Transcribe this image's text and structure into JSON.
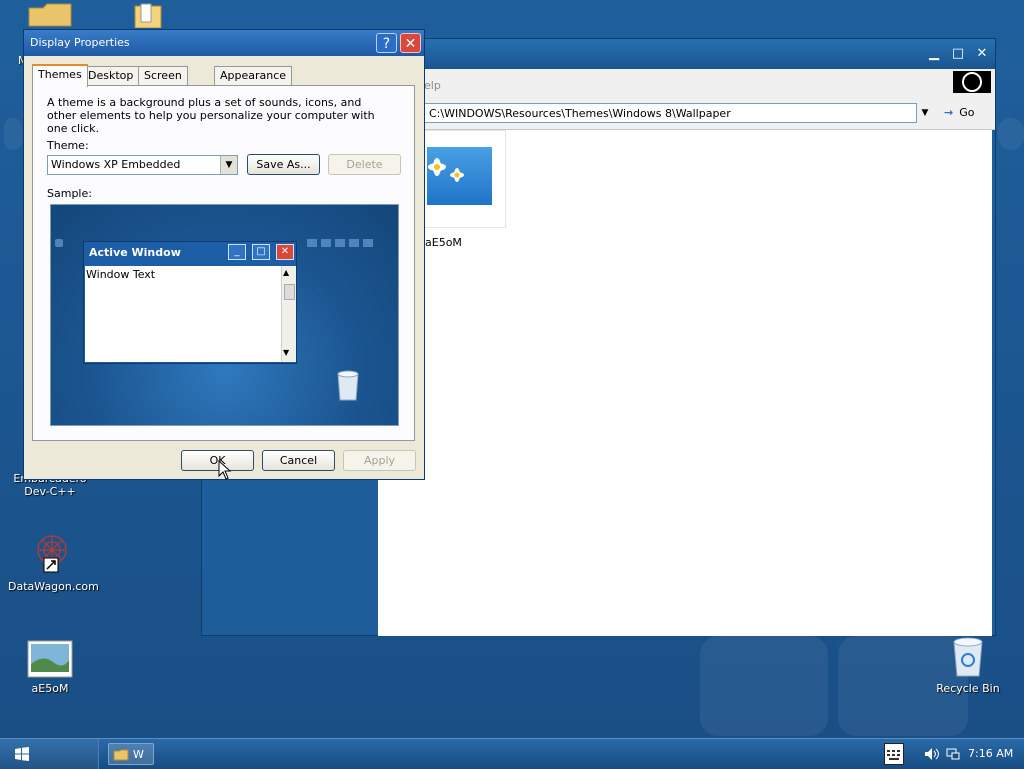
{
  "desktop": {
    "icons": [
      {
        "label": "M"
      },
      {
        "label": "Embarcadero Dev-C++",
        "line1": "Embarcadero",
        "line2": "Dev-C++"
      },
      {
        "label": "DataWagon.com"
      },
      {
        "label": "aE5oM"
      },
      {
        "label": "Recycle Bin"
      }
    ]
  },
  "explorer": {
    "menu_help": "elp",
    "address": "C:\\WINDOWS\\Resources\\Themes\\Windows 8\\Wallpaper",
    "go_label": "Go",
    "file": {
      "name": "aE5oM"
    },
    "controls": {
      "minimize": "▁",
      "maximize": "□",
      "close": "✕"
    }
  },
  "dialog": {
    "title": "Display Properties",
    "help_btn": "?",
    "close_btn": "✕",
    "tabs": [
      "Themes",
      "Desktop",
      "Screen Saver",
      "Appearance"
    ],
    "active_tab": "Themes",
    "description": "A theme is a background plus a set of sounds, icons, and other elements to help you personalize your computer with one click.",
    "theme_label": "Theme:",
    "theme_value": "Windows XP Embedded",
    "save_as": "Save As...",
    "delete": "Delete",
    "sample_label": "Sample:",
    "sample": {
      "window_title": "Active Window",
      "window_text": "Window Text"
    },
    "buttons": {
      "ok": "OK",
      "cancel": "Cancel",
      "apply": "Apply"
    }
  },
  "taskbar": {
    "task_label": "W",
    "clock": "7:16 AM"
  },
  "colors": {
    "desktop": "#1d5d99",
    "titlebar": "#1c5aa5",
    "close_red": "#d9483b",
    "tab_accent": "#e68b2c"
  }
}
